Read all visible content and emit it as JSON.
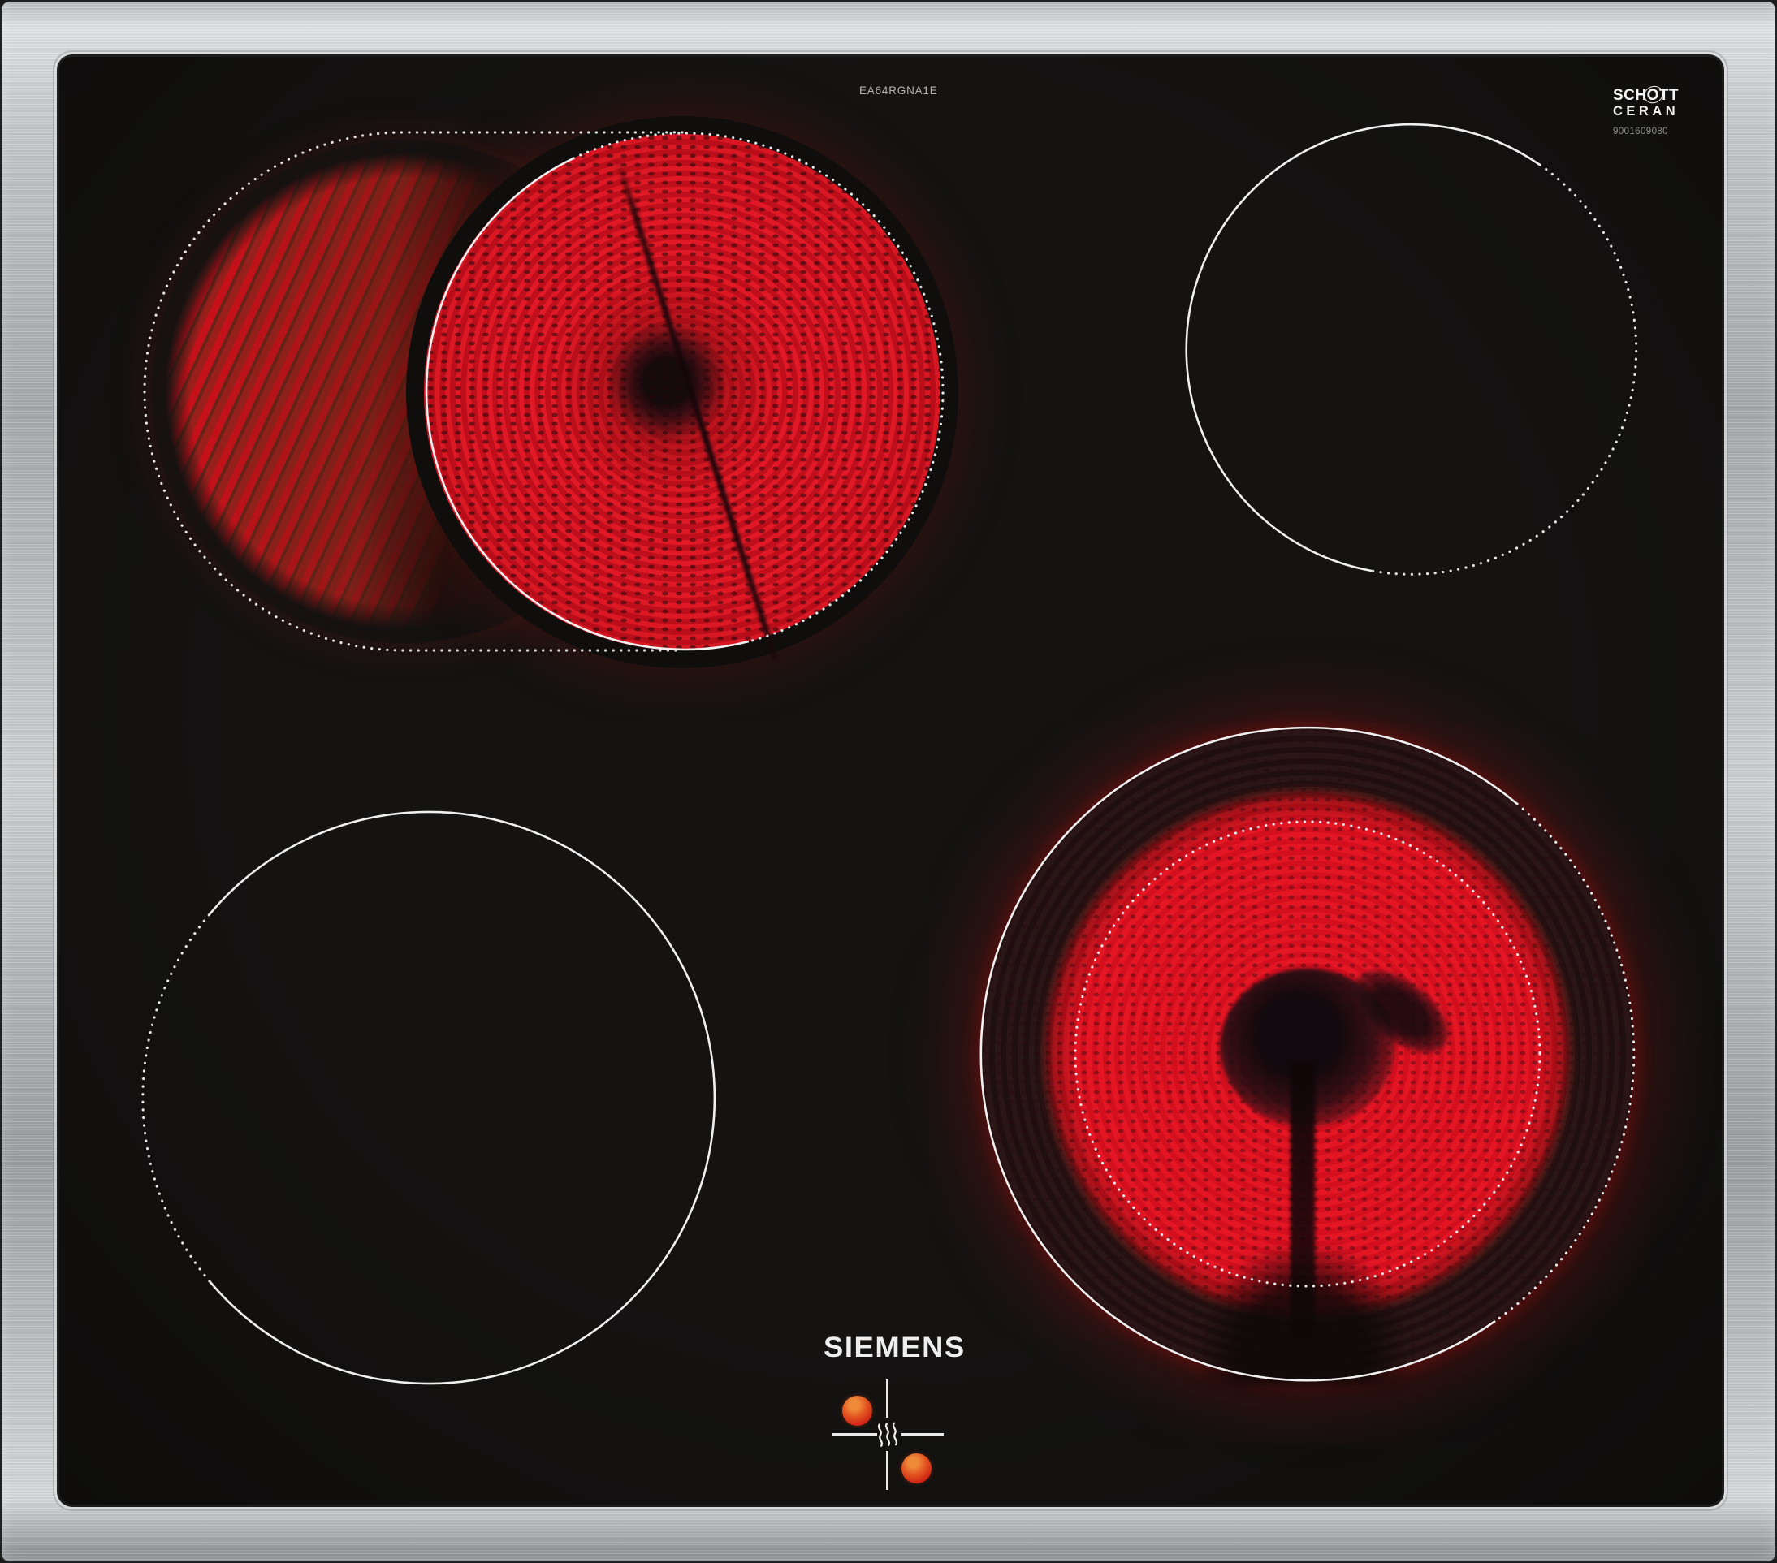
{
  "product": {
    "model_label": "EA64RGNA1E"
  },
  "branding": {
    "manufacturer_logo": "SIEMENS",
    "glass_brand": {
      "line1_part_a": "SCH",
      "line1_part_o": "O",
      "line1_part_b": "TT",
      "line2": "CERAN",
      "code": "9001609080"
    }
  },
  "surface": {
    "type": "glass-ceramic hob with 4 radiant zones",
    "frame": "brushed stainless steel trim",
    "glass_color": "#121110",
    "marking_color": "#f0f0f0"
  },
  "zones": [
    {
      "name": "rear-left-dual-extension-zone",
      "shape": "stadium (circle plus side extension)",
      "state": "on",
      "appearance": "bright red glowing coil disc, dimmer red herringbone glow in left extension, dark center filament shadow",
      "marking": "dotted outline around zone, solid arc on inner left of main disc"
    },
    {
      "name": "rear-right-zone",
      "shape": "circle",
      "state": "off",
      "appearance": "black glass",
      "marking": "thin white circle, solid upper-left, dotted right side"
    },
    {
      "name": "front-left-zone",
      "shape": "circle",
      "state": "off",
      "appearance": "black glass",
      "marking": "thin white circle, solid, dotted left side"
    },
    {
      "name": "front-right-dual-ring-zone",
      "shape": "circle",
      "state": "on",
      "appearance": "bright red outer ring and inner disc with dark gap ring, dark center element and stem shadow",
      "marking": "solid outer circle dotted on right, fully dotted inner circle"
    }
  ],
  "indicators": {
    "description": "residual heat indicator cluster with crosshair, heat-wave symbol and two glowing dots",
    "heat_dot_color": "#e25420",
    "crosshair_color": "#e9e9e9"
  },
  "colors": {
    "glow_red": "#e01020",
    "glow_dark_maroon": "#5c150f",
    "steel_light": "#e2e5e6",
    "steel_dark": "#8a8e91"
  }
}
